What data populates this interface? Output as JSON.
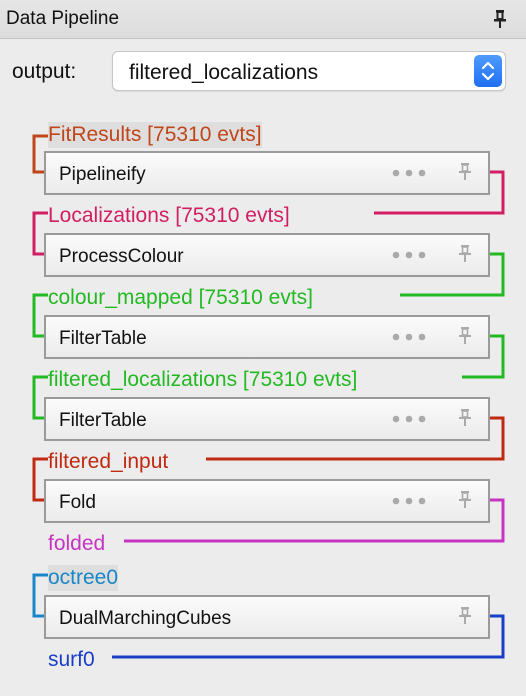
{
  "window": {
    "title": "Data Pipeline"
  },
  "output": {
    "label": "output:",
    "selected": "filtered_localizations"
  },
  "colors": {
    "fit": "#c0461a",
    "localizations": "#d11e63",
    "colour_mapped": "#23b922",
    "filtered_input": "#c02a10",
    "folded": "#c734c2",
    "octree": "#1a86c7",
    "surf": "#1a3fc7"
  },
  "pipeline": {
    "datasources": [
      {
        "label": "FitResults [75310 evts]"
      },
      {
        "label": "Localizations [75310 evts]"
      },
      {
        "label": "colour_mapped [75310 evts]"
      },
      {
        "label": "filtered_localizations [75310 evts]"
      },
      {
        "label": "filtered_input"
      },
      {
        "label": "folded"
      },
      {
        "label": "octree0"
      },
      {
        "label": "surf0"
      }
    ],
    "modules": [
      {
        "label": "Pipelineify"
      },
      {
        "label": "ProcessColour"
      },
      {
        "label": "FilterTable"
      },
      {
        "label": "FilterTable"
      },
      {
        "label": "Fold"
      },
      {
        "label": "DualMarchingCubes"
      }
    ]
  }
}
